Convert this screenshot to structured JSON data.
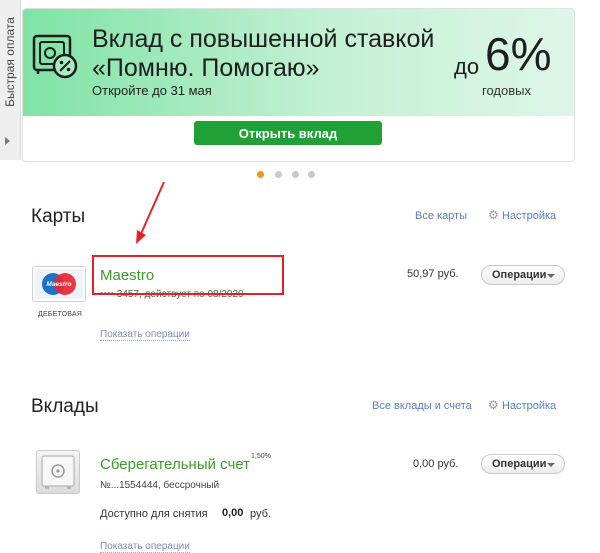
{
  "quickpay": {
    "label": "Быстрая оплата"
  },
  "banner": {
    "title_line1": "Вклад с повышенной ставкой",
    "title_line2": "«Помню. Помогаю»",
    "subtitle": "Откройте до 31 мая",
    "rate_prefix": "до",
    "rate": "6%",
    "rate_suffix": "годовых",
    "button_label": "Открыть вклад",
    "slides": 4,
    "active_slide": 1
  },
  "cards": {
    "title": "Карты",
    "all_link": "Все карты",
    "settings_link": "Настройка",
    "items": [
      {
        "name": "Maestro",
        "type_label": "ДЕБЕТОВАЯ",
        "brand_text": "Maestro",
        "info": "•••• 3457, действует по 08/2020",
        "amount": "50,97 руб.",
        "ops_label": "Операции",
        "show_ops": "Показать операции"
      }
    ]
  },
  "deposits": {
    "title": "Вклады",
    "all_link": "Все вклады и счета",
    "settings_link": "Настройка",
    "items": [
      {
        "name": "Сберегательный счет",
        "rate": "1,50%",
        "info": "№...1554444, бессрочный",
        "amount": "0,00 руб.",
        "ops_label": "Операции",
        "available_label": "Доступно для снятия",
        "available_value": "0,00",
        "available_currency": "руб.",
        "show_ops": "Показать операции"
      }
    ]
  },
  "colors": {
    "accent_green": "#21a038",
    "link_green": "#3c9a2a",
    "highlight_red": "#e4212b",
    "active_dot": "#f0931f"
  }
}
